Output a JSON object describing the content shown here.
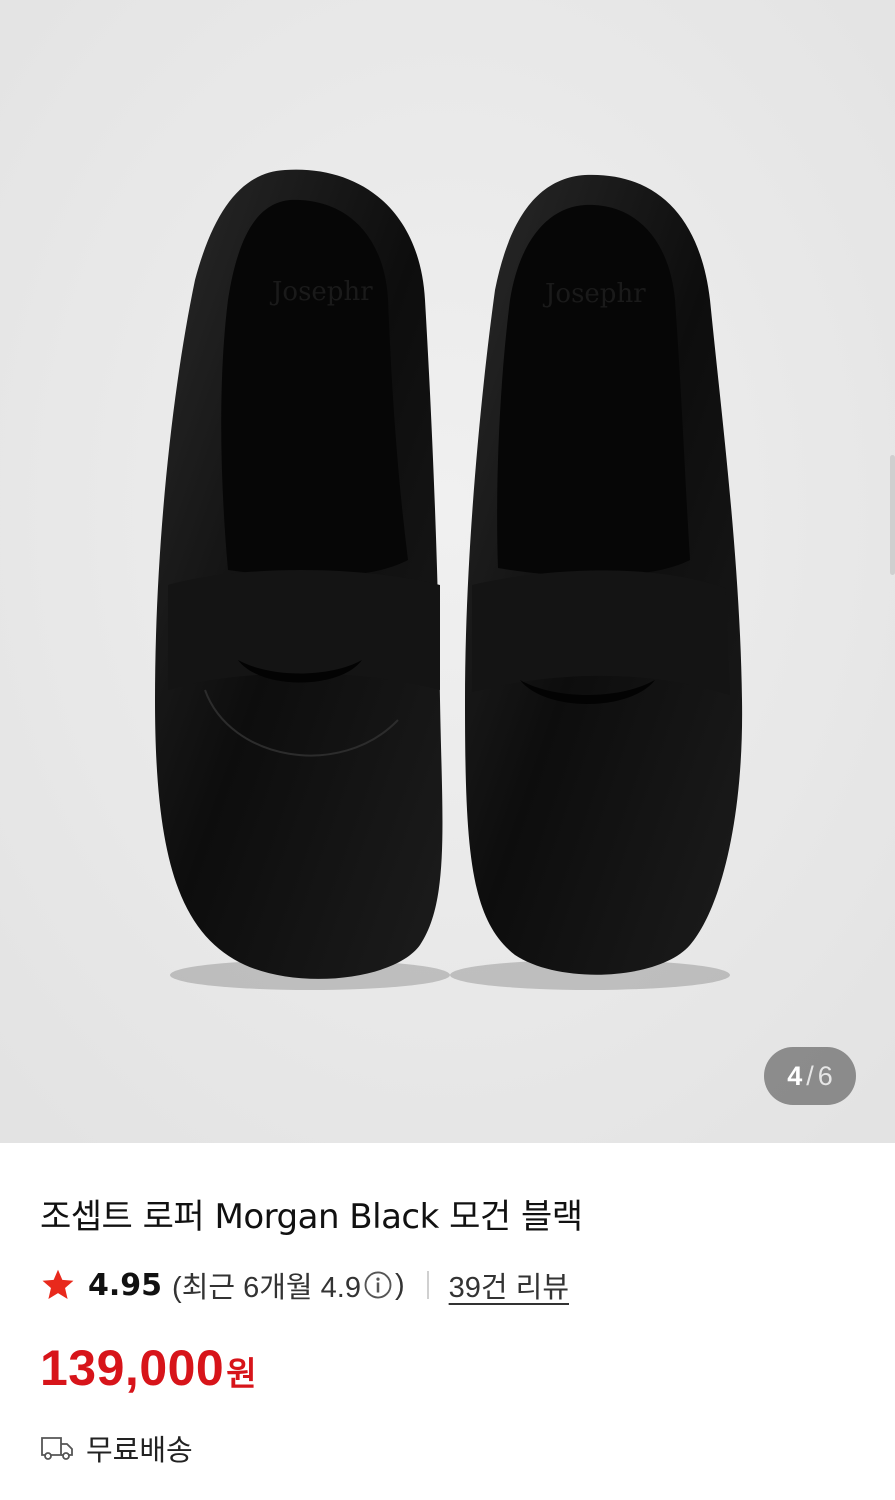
{
  "gallery": {
    "image_alt": "조셉트 로퍼 Morgan Black 모건 블랙",
    "current": "4",
    "separator": "/",
    "total": "6"
  },
  "product": {
    "title": "조셉트 로퍼 Morgan Black 모건 블랙",
    "rating": {
      "score": "4.95",
      "recent_text": "(최근 6개월 4.9",
      "recent_close": ")",
      "reviews_link": "39건 리뷰",
      "icon": "star-icon",
      "info_icon": "info-circle-icon",
      "star_color": "#e8291c"
    },
    "price": {
      "value": "139,000",
      "unit": "원",
      "color": "#d7141a"
    },
    "shipping": {
      "icon": "truck-icon",
      "label": "무료배송"
    }
  }
}
